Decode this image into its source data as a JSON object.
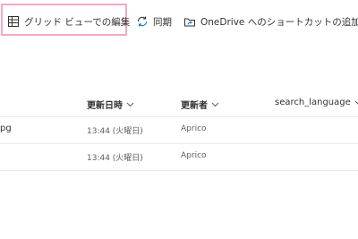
{
  "toolbar": {
    "grid_edit": {
      "label": "グリッド ビューでの編集",
      "icon": "grid-table-icon"
    },
    "sync": {
      "label": "同期",
      "icon": "sync-icon"
    },
    "shortcut": {
      "label": "OneDrive へのショートカットの追加",
      "icon": "onedrive-shortcut-icon"
    },
    "highlight_color": "#f4a8c6"
  },
  "columns": {
    "modified": "更新日時",
    "modified_by": "更新者",
    "search_language": "search_language"
  },
  "rows": [
    {
      "name": "pg",
      "modified": "13:44 (火曜日)",
      "modified_by": "Aprico"
    },
    {
      "name": "",
      "modified": "13:44 (火曜日)",
      "modified_by": "Aprico"
    }
  ],
  "colors": {
    "text": "#323130",
    "secondary": "#605e5c",
    "divider": "#edebe9",
    "accent": "#0078d4"
  }
}
